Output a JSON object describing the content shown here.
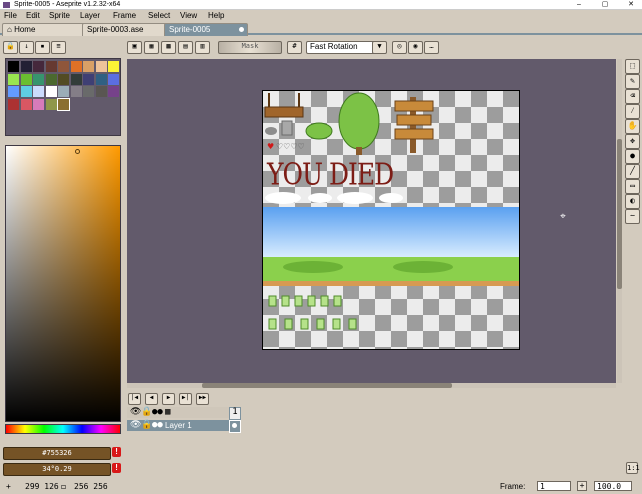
{
  "window": {
    "title": "Sprite-0005 - Aseprite v1.2.32-x64",
    "controls": [
      "–",
      "▢",
      "✕"
    ]
  },
  "menu": [
    "File",
    "Edit",
    "Sprite",
    "Layer",
    "Frame",
    "Select",
    "View",
    "Help"
  ],
  "tabs": [
    {
      "label": "Home"
    },
    {
      "label": "Sprite-0003.ase"
    },
    {
      "label": "Sprite-0005"
    }
  ],
  "toolbar": {
    "mask_label": "Mask",
    "rotation_algorithm": "Fast Rotation"
  },
  "palette": {
    "colors": [
      "#000000",
      "#222034",
      "#45283c",
      "#663931",
      "#8f563b",
      "#df7126",
      "#d9a066",
      "#eec39a",
      "#fbf236",
      "#99e550",
      "#6abe30",
      "#37946e",
      "#4b692f",
      "#524b24",
      "#323c39",
      "#3f3f74",
      "#306082",
      "#5b6ee1",
      "#639bff",
      "#5fcde4",
      "#cbdbfc",
      "#ffffff",
      "#9badb7",
      "#847e87",
      "#696a6a",
      "#595652",
      "#76428a",
      "#ac3232",
      "#d95763",
      "#d77bba",
      "#8f974a",
      "#8a6f30"
    ],
    "selected_index": 31
  },
  "colors": {
    "foreground_hex": "#755326",
    "background_hex": "#755326",
    "foreground_label": "#755326",
    "background_label": "34°0.29",
    "warning_glyph": "!"
  },
  "sprite_text": "YOU DIED",
  "timeline": {
    "frame_number": "1",
    "layer_name": "Layer 1"
  },
  "status": {
    "coords": "299 126",
    "size": "256 256",
    "frame_label": "Frame:",
    "frame_value": "1",
    "zoom": "100.0"
  },
  "icons": [
    "lock-icon",
    "arrow-down-icon",
    "doc-icon",
    "list-icon",
    "eye-icon",
    "marquee-icon",
    "pencil-icon",
    "eraser-icon",
    "eyedropper-icon",
    "hand-icon",
    "move-icon",
    "bucket-icon",
    "line-icon",
    "rect-icon",
    "blur-icon",
    "crosshair-icon"
  ]
}
